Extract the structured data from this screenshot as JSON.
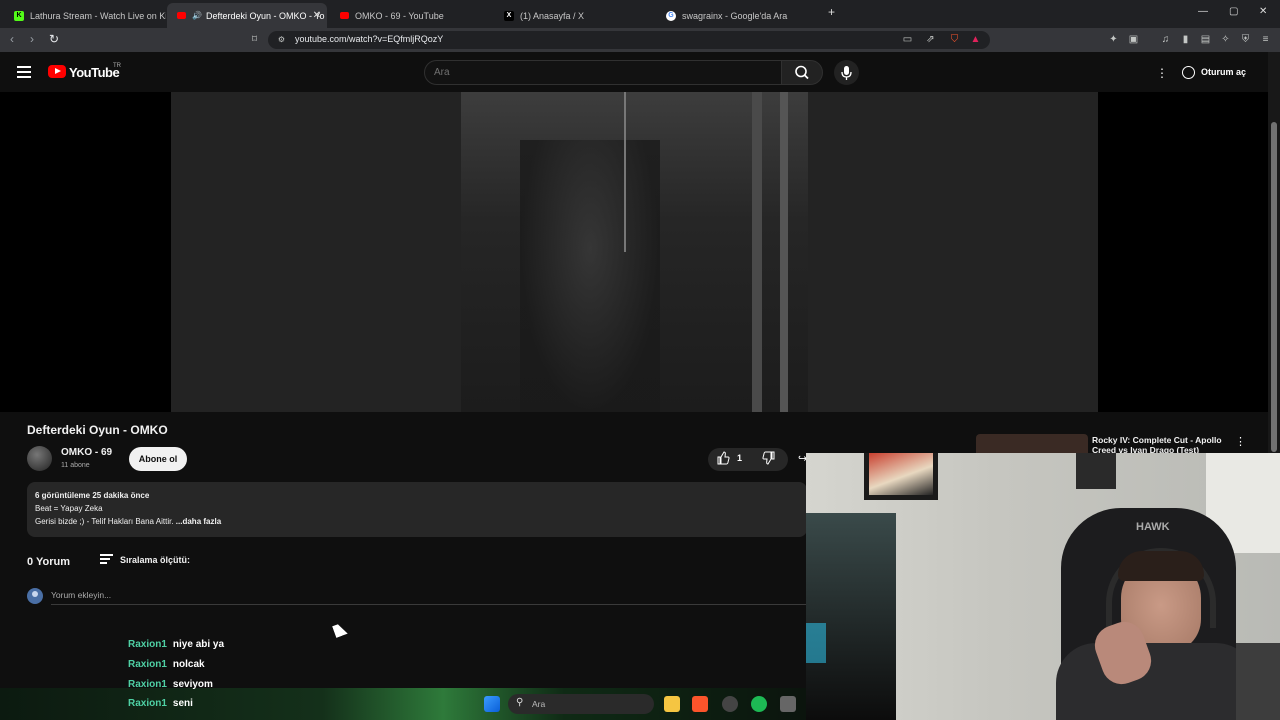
{
  "browser": {
    "tabs": [
      {
        "title": "Lathura Stream - Watch Live on Kick",
        "favicon": "kick-icon",
        "active": false
      },
      {
        "title": "Defterdeki Oyun - OMKO - Yo",
        "favicon": "youtube-icon",
        "active": true
      },
      {
        "title": "OMKO - 69 - YouTube",
        "favicon": "youtube-icon",
        "active": false
      },
      {
        "title": "(1) Anasayfa / X",
        "favicon": "x-icon",
        "active": false
      },
      {
        "title": "swagrainx - Google'da Ara",
        "favicon": "google-icon",
        "active": false
      }
    ],
    "url": "youtube.com/watch?v=EQfmljRQozY",
    "new_tab": "+",
    "controls": {
      "minimize": "—",
      "maximize": "▢",
      "close": "✕"
    }
  },
  "youtube": {
    "wordmark": "YouTube",
    "country": "TR",
    "search_placeholder": "Ara",
    "signin_label": "Oturum aç",
    "video": {
      "title": "Defterdeki Oyun - OMKO",
      "channel_name": "OMKO - 69",
      "subscribers": "11 abone",
      "subscribe_label": "Abone ol",
      "like_count": "1",
      "description": {
        "stats": "6 görüntüleme  25 dakika önce",
        "line1": "Beat = Yapay Zeka",
        "line2": "Gerisi bizde ;) - Telif Hakları Bana Aittir. ",
        "more": "...daha fazla"
      }
    },
    "comments": {
      "count_label": "0 Yorum",
      "sort_label": "Sıralama ölçütü:",
      "input_placeholder": "Yorum ekleyin..."
    },
    "recommended": {
      "title": "Rocky IV: Complete Cut - Apollo Creed vs Ivan Drago (Test)"
    }
  },
  "stream_chat": [
    {
      "user": "Raxion1",
      "message": "niye abi ya"
    },
    {
      "user": "Raxion1",
      "message": "nolcak"
    },
    {
      "user": "Raxion1",
      "message": "seviyom"
    },
    {
      "user": "Raxion1",
      "message": "seni"
    }
  ],
  "taskbar": {
    "search_placeholder": "Ara"
  },
  "colors": {
    "chat_user": "#4fd1a5",
    "youtube_red": "#ff0000"
  }
}
